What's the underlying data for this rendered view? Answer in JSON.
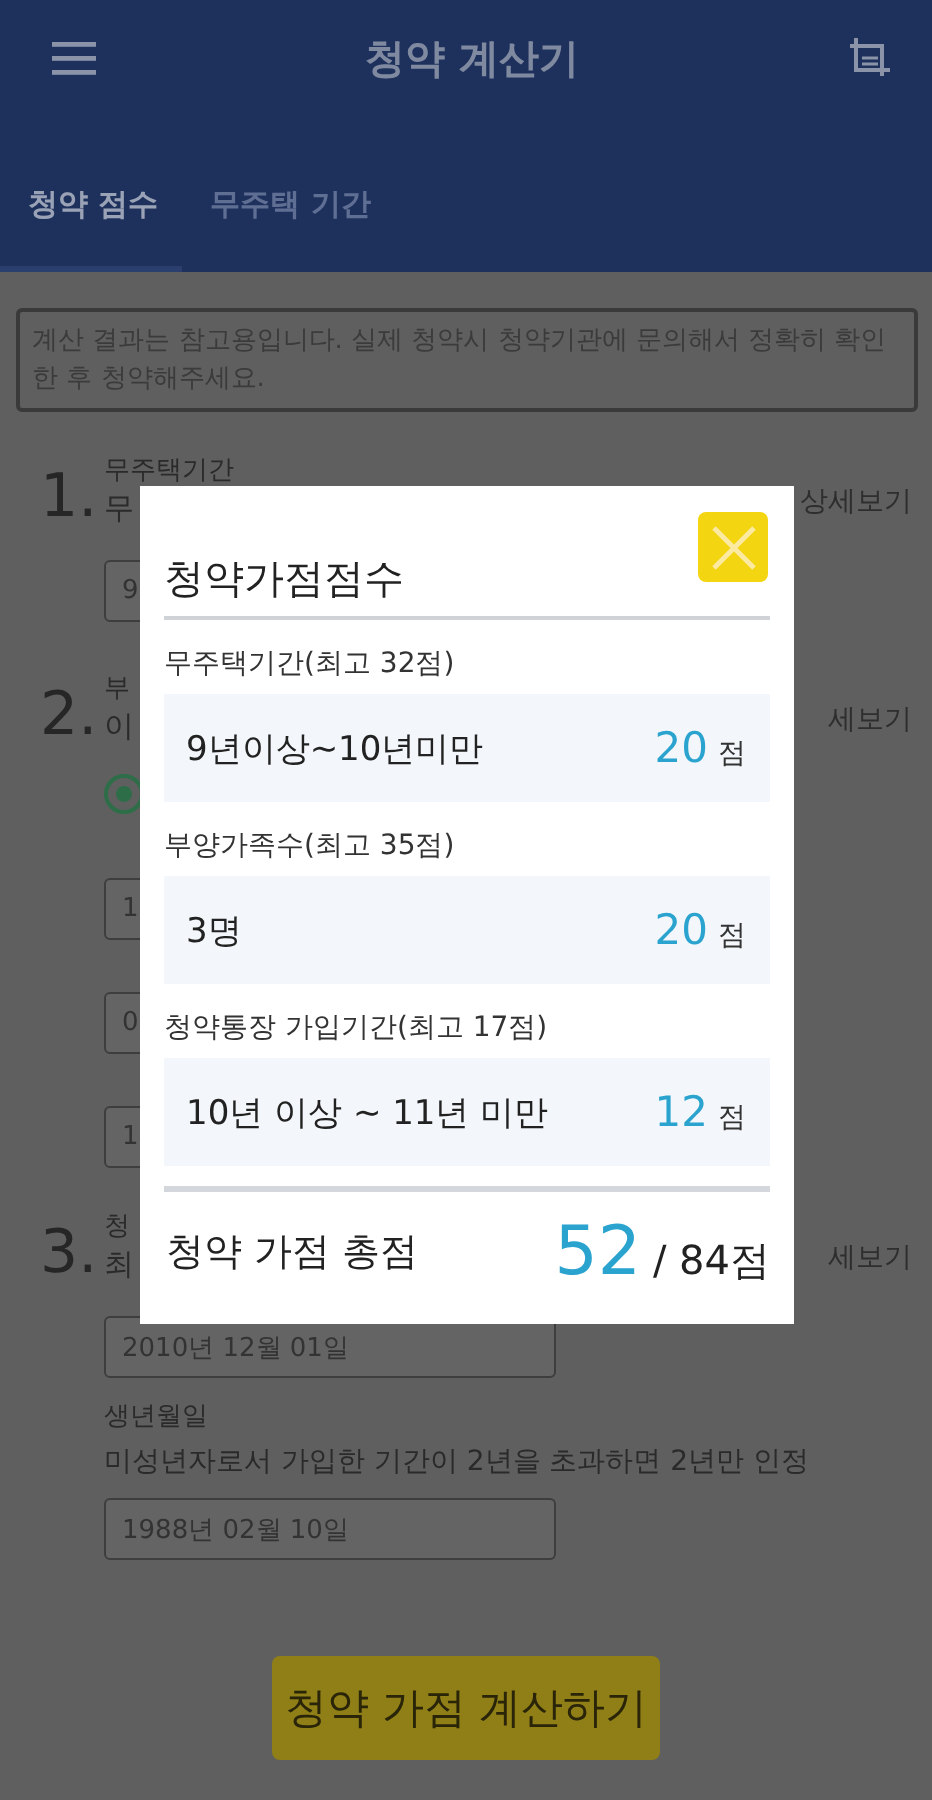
{
  "app_bar": {
    "title": "청약 계산기"
  },
  "tabs": [
    {
      "label": "청약 점수",
      "selected": true
    },
    {
      "label": "무주택 기간",
      "selected": false
    }
  ],
  "notice": "계산 결과는 참고용입니다. 실제 청약시 청약기관에 문의해서 정확히 확인 한 후 청약해주세요.",
  "sections": [
    {
      "number": "1.",
      "detail_link": "상세보기",
      "items": [
        {
          "kind": "title",
          "text": "무주택기간"
        },
        {
          "kind": "subtitle",
          "text": "무"
        },
        {
          "kind": "field",
          "value": "9"
        }
      ]
    },
    {
      "number": "2.",
      "detail_link": "세보기",
      "items": [
        {
          "kind": "title",
          "text": "부"
        },
        {
          "kind": "subtitle",
          "text": "이"
        },
        {
          "kind": "radio",
          "selected": true
        },
        {
          "kind": "field",
          "value": "1"
        },
        {
          "kind": "field",
          "value": "0"
        },
        {
          "kind": "field",
          "value": "1"
        }
      ]
    },
    {
      "number": "3.",
      "detail_link": "세보기",
      "items": [
        {
          "kind": "title",
          "text": "청"
        },
        {
          "kind": "subtitle",
          "text": "최"
        },
        {
          "kind": "field",
          "value": "2010년 12월 01일"
        },
        {
          "kind": "label",
          "text": "생년월일"
        },
        {
          "kind": "note",
          "text": "미성년자로서 가입한 기간이 2년을 초과하면 2년만 인정"
        },
        {
          "kind": "field",
          "value": "1988년 02월 10일"
        }
      ]
    }
  ],
  "calculate_button": "청약 가점 계산하기",
  "dialog": {
    "title": "청약가점점수",
    "groups": [
      {
        "label": "무주택기간(최고 32점)",
        "value": "9년이상~10년미만",
        "score": "20",
        "unit": "점"
      },
      {
        "label": "부양가족수(최고 35점)",
        "value": "3명",
        "score": "20",
        "unit": "점"
      },
      {
        "label": "청약통장 가입기간(최고 17점)",
        "value": "10년 이상 ~ 11년 미만",
        "score": "12",
        "unit": "점"
      }
    ],
    "total": {
      "label": "청약 가점 총점",
      "score": "52",
      "max": "/ 84점"
    }
  }
}
